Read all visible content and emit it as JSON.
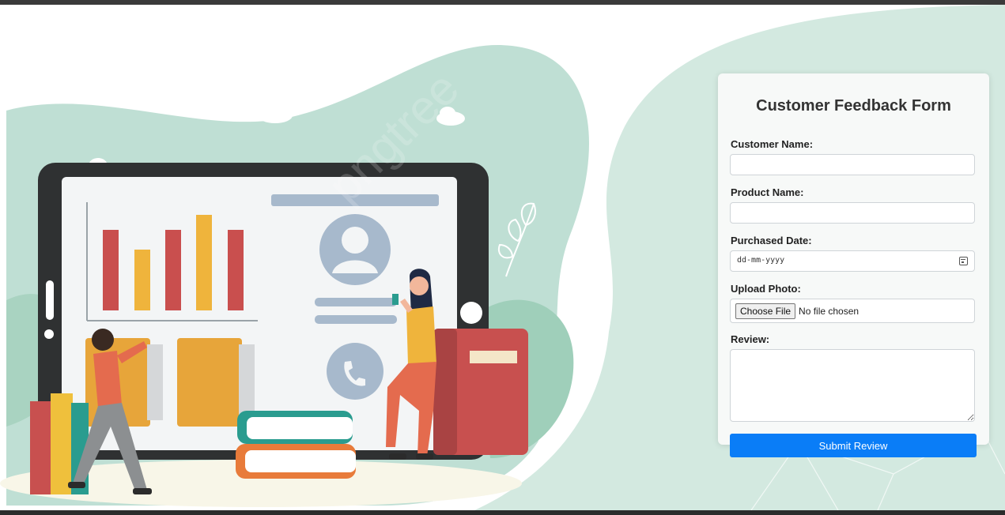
{
  "colors": {
    "accent": "#0a7df7",
    "background_green": "#cfe5dc",
    "card_background": "#f7f9f8"
  },
  "illustration": {
    "watermark": "pngtree",
    "icons": [
      "bar-chart-icon",
      "profile-icon",
      "phone-icon",
      "cloud-icon",
      "book-icon",
      "notebook-icon",
      "leaf-icon"
    ]
  },
  "form": {
    "title": "Customer Feedback Form",
    "customer_name": {
      "label": "Customer Name:",
      "value": ""
    },
    "product_name": {
      "label": "Product Name:",
      "value": ""
    },
    "purchased_date": {
      "label": "Purchased Date:",
      "placeholder": "dd-mm-yyyy",
      "icon": "calendar-icon"
    },
    "upload_photo": {
      "label": "Upload Photo:",
      "button_label": "Choose File",
      "status": "No file chosen"
    },
    "review": {
      "label": "Review:",
      "value": ""
    },
    "submit_label": "Submit Review"
  }
}
